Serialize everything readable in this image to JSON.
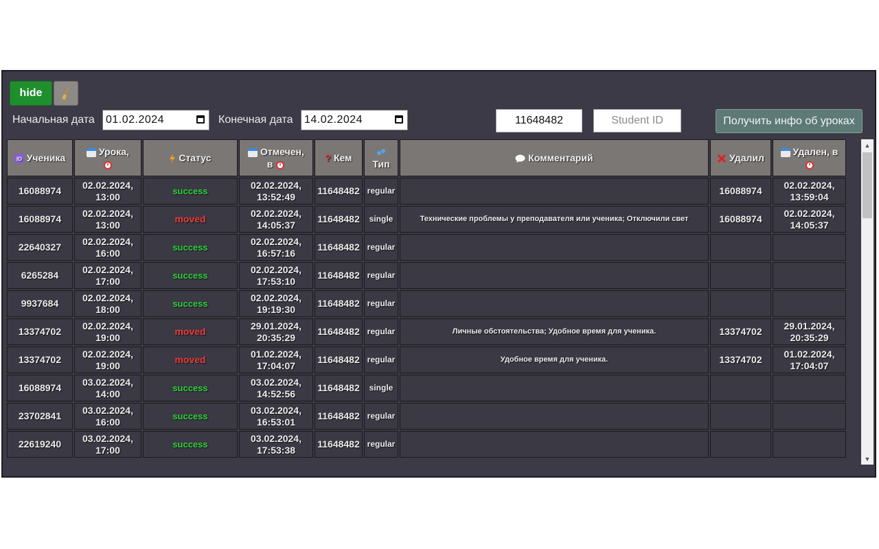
{
  "controls": {
    "hide_label": "hide",
    "start_date_label": "Начальная дата",
    "start_date_value": "01.02.2024",
    "end_date_label": "Конечная дата",
    "end_date_value": "14.02.2024",
    "teacher_id_value": "11648482",
    "student_id_placeholder": "Student ID",
    "get_info_label": "Получить инфо об уроках"
  },
  "table": {
    "headers": {
      "student": "Ученика",
      "lesson_l1": "Урока,",
      "status": "Статус",
      "marked_l1": "Отмечен,",
      "marked_l2": "в",
      "by": "Кем",
      "type": "Тип",
      "comment": "Комментарий",
      "deleted_by": "Удалил",
      "deleted_at": "Удален, в"
    },
    "rows": [
      {
        "student": "16088974",
        "lesson_date": "02.02.2024,",
        "lesson_time": "13:00",
        "status": "success",
        "marked_date": "02.02.2024,",
        "marked_time": "13:52:49",
        "by": "11648482",
        "type": "regular",
        "comment": "",
        "deleted_by": "16088974",
        "deleted_date": "02.02.2024,",
        "deleted_time": "13:59:04"
      },
      {
        "student": "16088974",
        "lesson_date": "02.02.2024,",
        "lesson_time": "13:00",
        "status": "moved",
        "marked_date": "02.02.2024,",
        "marked_time": "14:05:37",
        "by": "11648482",
        "type": "single",
        "comment": "Технические проблемы у преподавателя или ученика; Отключили свет",
        "deleted_by": "16088974",
        "deleted_date": "02.02.2024,",
        "deleted_time": "14:05:37"
      },
      {
        "student": "22640327",
        "lesson_date": "02.02.2024,",
        "lesson_time": "16:00",
        "status": "success",
        "marked_date": "02.02.2024,",
        "marked_time": "16:57:16",
        "by": "11648482",
        "type": "regular",
        "comment": "",
        "deleted_by": "",
        "deleted_date": "",
        "deleted_time": ""
      },
      {
        "student": "6265284",
        "lesson_date": "02.02.2024,",
        "lesson_time": "17:00",
        "status": "success",
        "marked_date": "02.02.2024,",
        "marked_time": "17:53:10",
        "by": "11648482",
        "type": "regular",
        "comment": "",
        "deleted_by": "",
        "deleted_date": "",
        "deleted_time": ""
      },
      {
        "student": "9937684",
        "lesson_date": "02.02.2024,",
        "lesson_time": "18:00",
        "status": "success",
        "marked_date": "02.02.2024,",
        "marked_time": "19:19:30",
        "by": "11648482",
        "type": "regular",
        "comment": "",
        "deleted_by": "",
        "deleted_date": "",
        "deleted_time": ""
      },
      {
        "student": "13374702",
        "lesson_date": "02.02.2024,",
        "lesson_time": "19:00",
        "status": "moved",
        "marked_date": "29.01.2024,",
        "marked_time": "20:35:29",
        "by": "11648482",
        "type": "regular",
        "comment": "Личные обстоятельства; Удобное время для ученика.",
        "deleted_by": "13374702",
        "deleted_date": "29.01.2024,",
        "deleted_time": "20:35:29"
      },
      {
        "student": "13374702",
        "lesson_date": "02.02.2024,",
        "lesson_time": "19:00",
        "status": "moved",
        "marked_date": "01.02.2024,",
        "marked_time": "17:04:07",
        "by": "11648482",
        "type": "regular",
        "comment": "Удобное время для ученика.",
        "deleted_by": "13374702",
        "deleted_date": "01.02.2024,",
        "deleted_time": "17:04:07"
      },
      {
        "student": "16088974",
        "lesson_date": "03.02.2024,",
        "lesson_time": "14:00",
        "status": "success",
        "marked_date": "03.02.2024,",
        "marked_time": "14:52:56",
        "by": "11648482",
        "type": "single",
        "comment": "",
        "deleted_by": "",
        "deleted_date": "",
        "deleted_time": ""
      },
      {
        "student": "23702841",
        "lesson_date": "03.02.2024,",
        "lesson_time": "16:00",
        "status": "success",
        "marked_date": "03.02.2024,",
        "marked_time": "16:53:01",
        "by": "11648482",
        "type": "regular",
        "comment": "",
        "deleted_by": "",
        "deleted_date": "",
        "deleted_time": ""
      },
      {
        "student": "22619240",
        "lesson_date": "03.02.2024,",
        "lesson_time": "17:00",
        "status": "success",
        "marked_date": "03.02.2024,",
        "marked_time": "17:53:38",
        "by": "11648482",
        "type": "regular",
        "comment": "",
        "deleted_by": "",
        "deleted_date": "",
        "deleted_time": ""
      }
    ]
  },
  "colors": {
    "panel_bg": "#3c3a47",
    "success": "#2fd13c",
    "moved": "#ef3b3b",
    "hide_button": "#1f8f2d"
  },
  "icons": {
    "student": "id-icon",
    "lesson": "calendar-icon",
    "alarm": "alarm-clock-icon",
    "status": "lightning-icon",
    "by": "question-icon",
    "type": "droplets-icon",
    "comment": "speech-bubble-icon",
    "deleted": "red-x-icon",
    "clear": "broom-icon"
  }
}
